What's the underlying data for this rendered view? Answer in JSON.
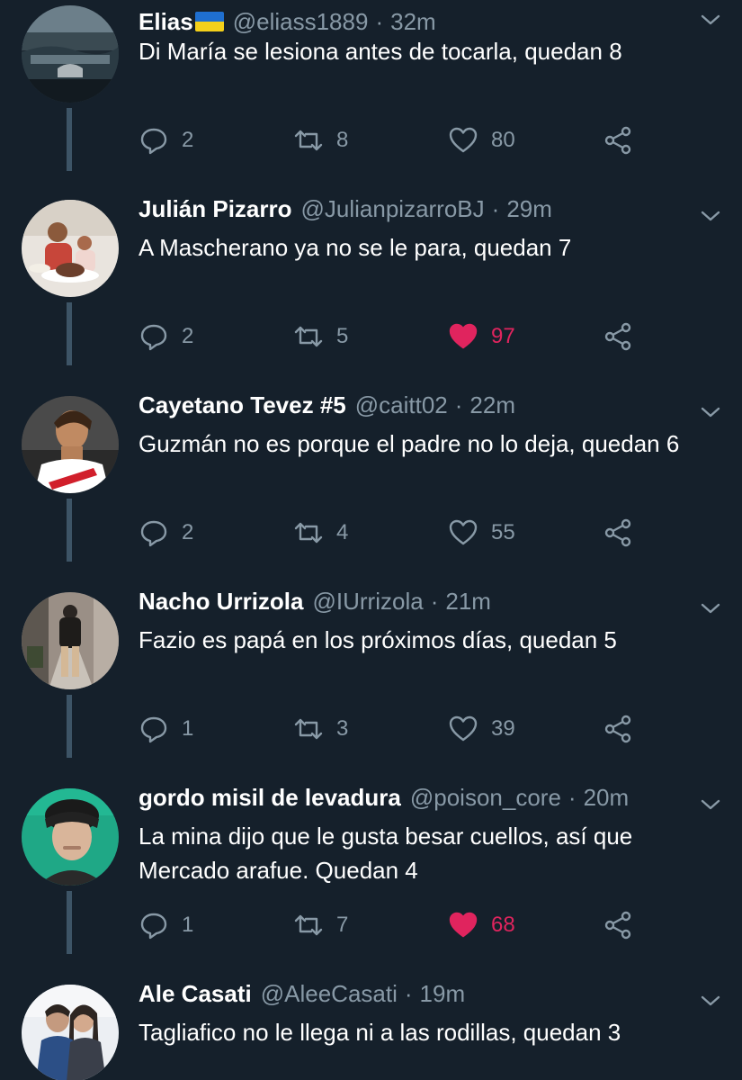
{
  "tweets": [
    {
      "name": "Elias",
      "flag": "ukraine-flag",
      "handle": "@eliass1889",
      "time": "32m",
      "text": "Di María se lesiona antes de tocarla, quedan 8",
      "replies": "2",
      "retweets": "8",
      "likes": "80",
      "liked": false
    },
    {
      "name": "Julián Pizarro",
      "handle": "@JulianpizarroBJ",
      "time": "29m",
      "text": "A Mascherano ya no se le para, quedan 7",
      "replies": "2",
      "retweets": "5",
      "likes": "97",
      "liked": true
    },
    {
      "name": "Cayetano Tevez #5",
      "handle": "@caitt02",
      "time": "22m",
      "text": "Guzmán no es porque el padre no lo deja, quedan 6",
      "replies": "2",
      "retweets": "4",
      "likes": "55",
      "liked": false
    },
    {
      "name": "Nacho Urrizola",
      "handle": "@IUrrizola",
      "time": "21m",
      "text": "Fazio es papá en los próximos días, quedan 5",
      "replies": "1",
      "retweets": "3",
      "likes": "39",
      "liked": false
    },
    {
      "name": "gordo misil de levadura",
      "handle": "@poison_core",
      "time": "20m",
      "text": "La mina dijo que le gusta besar cuellos, así que Mercado arafue. Quedan 4",
      "replies": "1",
      "retweets": "7",
      "likes": "68",
      "liked": true
    },
    {
      "name": "Ale Casati",
      "handle": "@AleeCasati",
      "time": "19m",
      "text": "Tagliafico no le llega ni a las rodillas, quedan 3"
    }
  ],
  "separator": "·",
  "colors": {
    "background": "#15202b",
    "secondary_text": "#8899a6",
    "like_active": "#e0245e",
    "thread_line": "#3d5466"
  }
}
